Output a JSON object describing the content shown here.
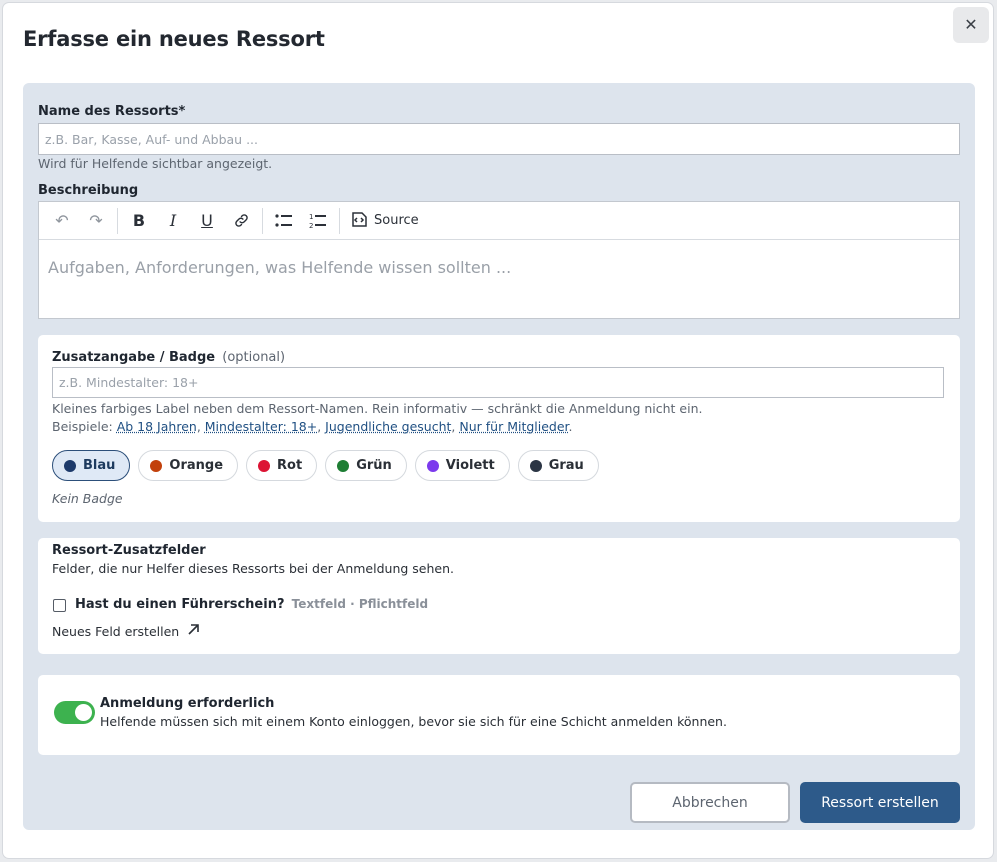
{
  "dialog": {
    "title": "Erfasse ein neues Ressort",
    "close_label": "✕"
  },
  "name_field": {
    "label": "Name des Ressorts*",
    "placeholder": "z.B. Bar, Kasse, Auf- und Abbau ...",
    "value": "",
    "hint": "Wird für Helfende sichtbar angezeigt."
  },
  "description": {
    "label": "Beschreibung",
    "toolbar": {
      "undo_icon": "↶",
      "redo_icon": "↷",
      "bold_icon": "B",
      "italic_icon": "I",
      "underline_icon": "U",
      "source_label": "Source"
    },
    "placeholder": "Aufgaben, Anforderungen, was Helfende wissen sollten ..."
  },
  "badge": {
    "label": "Zusatzangabe / Badge",
    "optional": "(optional)",
    "placeholder": "z.B. Mindestalter: 18+",
    "value": "",
    "hint": "Kleines farbiges Label neben dem Ressort-Namen. Rein informativ — schränkt die Anmeldung nicht ein.",
    "examples_prefix": "Beispiele:",
    "examples": [
      "Ab 18 Jahren",
      "Mindestalter: 18+",
      "Jugendliche gesucht",
      "Nur für Mitglieder"
    ],
    "colors": [
      {
        "label": "Blau",
        "color": "#1d3a6b",
        "selected": true
      },
      {
        "label": "Orange",
        "color": "#c2410c",
        "selected": false
      },
      {
        "label": "Rot",
        "color": "#dc1434",
        "selected": false
      },
      {
        "label": "Grün",
        "color": "#1e7e34",
        "selected": false
      },
      {
        "label": "Violett",
        "color": "#7c3aed",
        "selected": false
      },
      {
        "label": "Grau",
        "color": "#2b3544",
        "selected": false
      }
    ],
    "preview_text": "Kein Badge"
  },
  "extra_fields": {
    "title": "Ressort-Zusatzfelder",
    "subtitle": "Felder, die nur Helfer dieses Ressorts bei der Anmeldung sehen.",
    "field_label": "Hast du einen Führerschein?",
    "field_meta": "Textfeld · Pflichtfeld",
    "field_checked": false,
    "new_field_link": "Neues Feld erstellen"
  },
  "login": {
    "title": "Anmeldung erforderlich",
    "description": "Helfende müssen sich mit einem Konto einloggen, bevor sie sich für eine Schicht anmelden können.",
    "enabled": true
  },
  "actions": {
    "cancel": "Abbrechen",
    "create": "Ressort erstellen"
  },
  "theme": {
    "primary": "#2d5a8a",
    "toggle_on": "#3db24f",
    "panel_bg": "#dde4ed"
  }
}
